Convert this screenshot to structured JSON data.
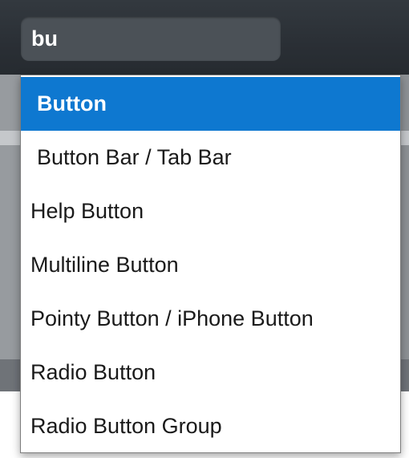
{
  "search": {
    "value": "bu"
  },
  "results": [
    {
      "label": "Button",
      "selected": true
    },
    {
      "label": "Button Bar / Tab Bar",
      "selected": false
    },
    {
      "label": "Help Button",
      "selected": false
    },
    {
      "label": "Multiline Button",
      "selected": false
    },
    {
      "label": "Pointy Button / iPhone Button",
      "selected": false
    },
    {
      "label": "Radio Button",
      "selected": false
    },
    {
      "label": "Radio Button Group",
      "selected": false
    }
  ],
  "colors": {
    "selection": "#0e78d0",
    "toolbar": "#2d3238",
    "search_field": "#4b5157"
  }
}
